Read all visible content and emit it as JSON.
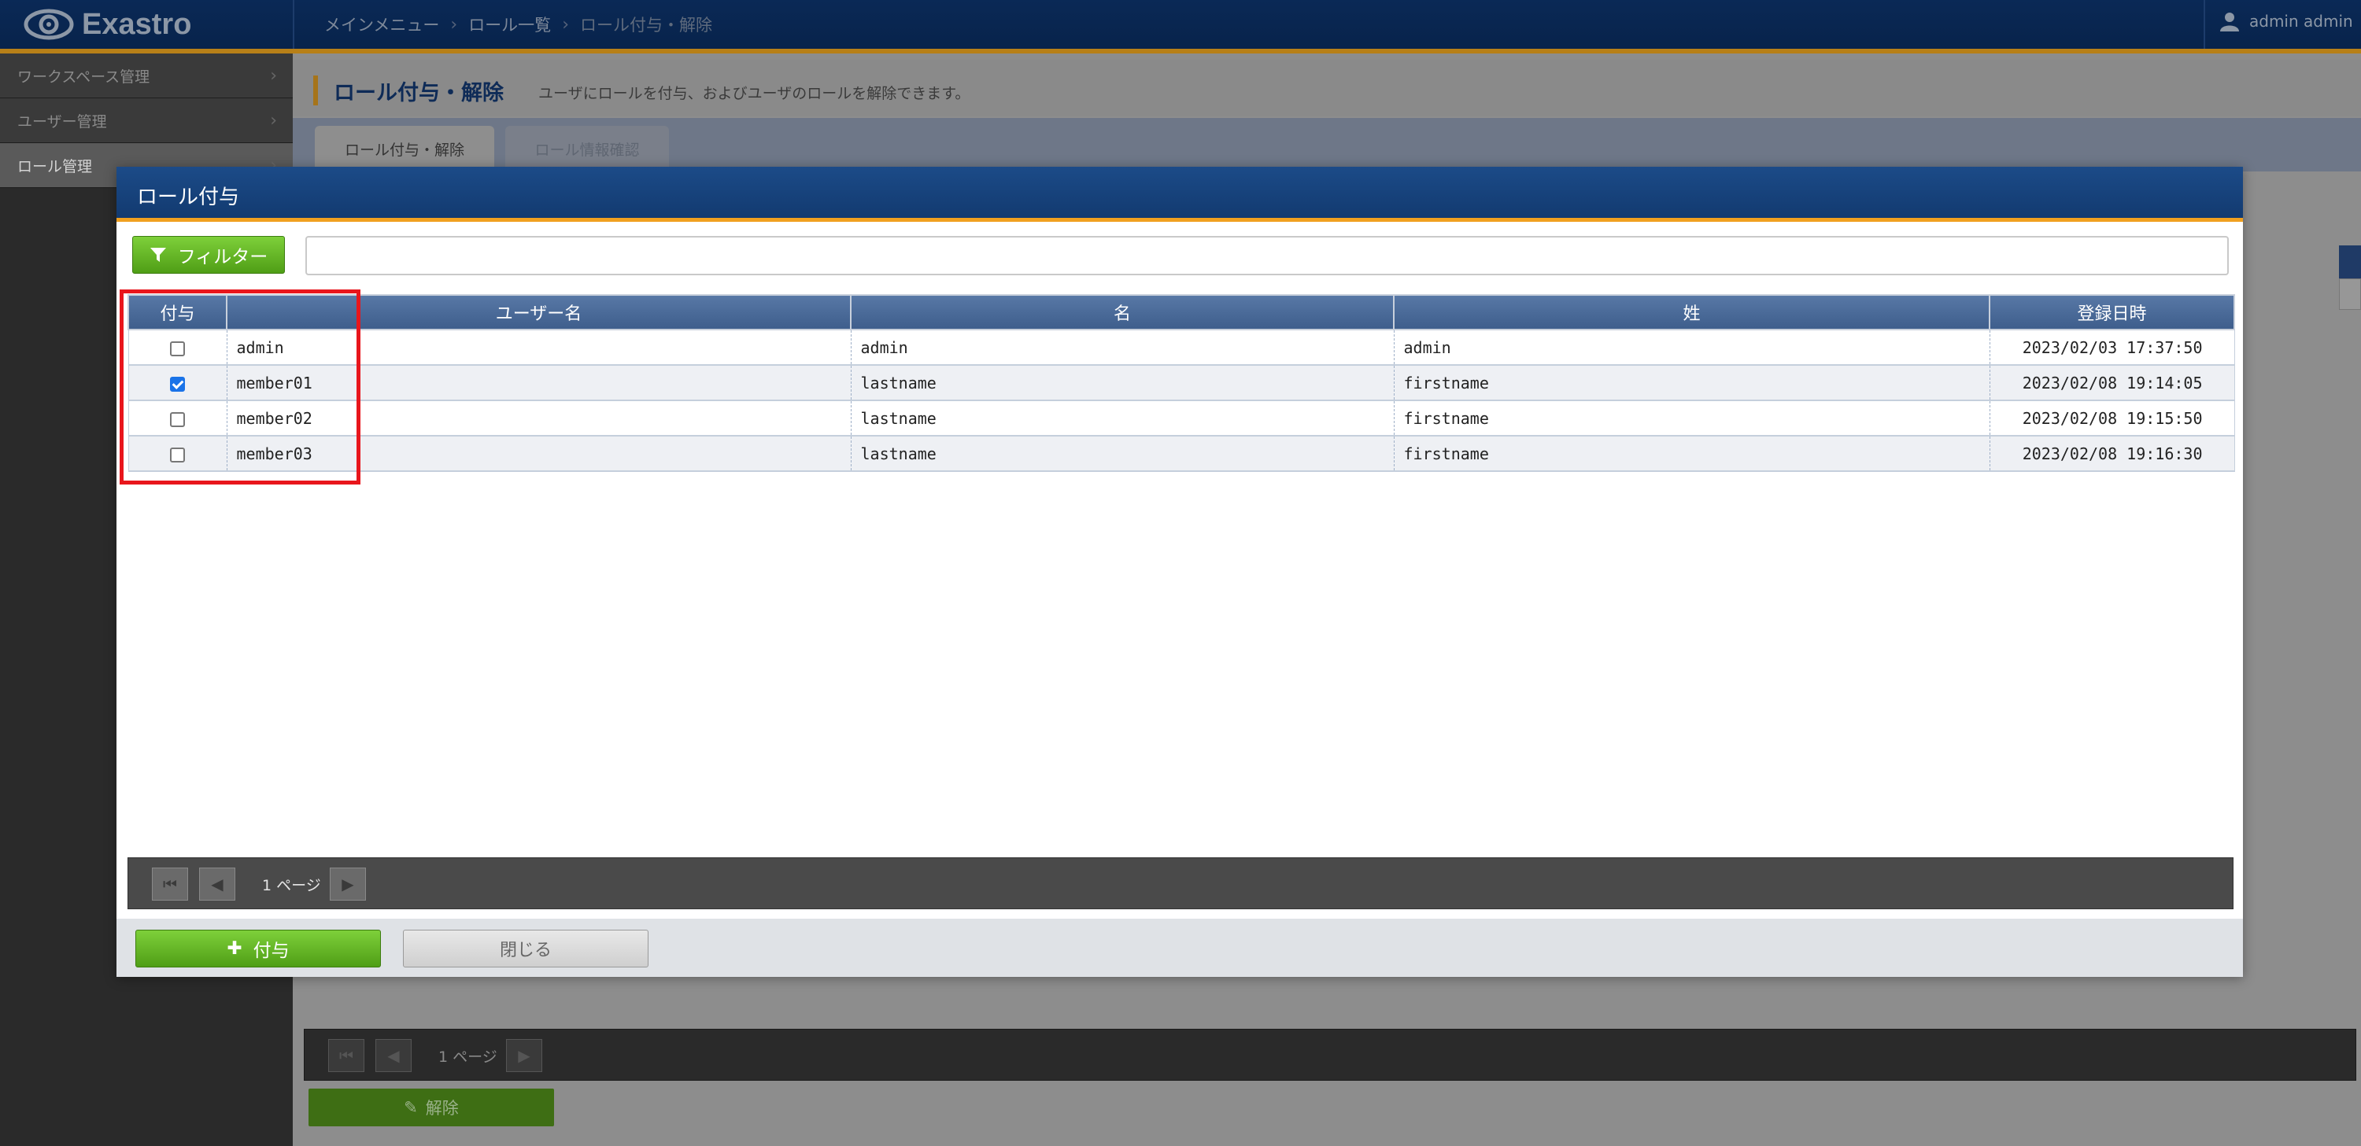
{
  "app": {
    "logo_text": "Exastro",
    "user_name": "admin admin",
    "breadcrumb": [
      "メインメニュー",
      "ロール一覧",
      "ロール付与・解除"
    ]
  },
  "sidebar": {
    "items": [
      {
        "label": "ワークスペース管理"
      },
      {
        "label": "ユーザー管理"
      },
      {
        "label": "ロール管理"
      }
    ]
  },
  "main": {
    "title": "ロール付与・解除",
    "description": "ユーザにロールを付与、およびユーザのロールを解除できます。",
    "tabs": [
      "ロール付与・解除",
      "ロール情報確認"
    ],
    "pager_label": "1 ページ",
    "release_label": "解除"
  },
  "modal": {
    "title": "ロール付与",
    "filter_label": "フィルター",
    "filter_value": "",
    "columns": [
      "付与",
      "ユーザー名",
      "名",
      "姓",
      "登録日時"
    ],
    "rows": [
      {
        "checked": false,
        "username": "admin",
        "first": "admin",
        "last": "admin",
        "created": "2023/02/03 17:37:50"
      },
      {
        "checked": true,
        "username": "member01",
        "first": "lastname",
        "last": "firstname",
        "created": "2023/02/08 19:14:05"
      },
      {
        "checked": false,
        "username": "member02",
        "first": "lastname",
        "last": "firstname",
        "created": "2023/02/08 19:15:50"
      },
      {
        "checked": false,
        "username": "member03",
        "first": "lastname",
        "last": "firstname",
        "created": "2023/02/08 19:16:30"
      }
    ],
    "pager_label": "1 ページ",
    "grant_label": "付与",
    "close_label": "閉じる"
  },
  "colors": {
    "header_navy": "#0a2956",
    "accent_orange": "#f0a020",
    "green_button": "#5aa81e",
    "highlight_red": "#e8161c"
  }
}
